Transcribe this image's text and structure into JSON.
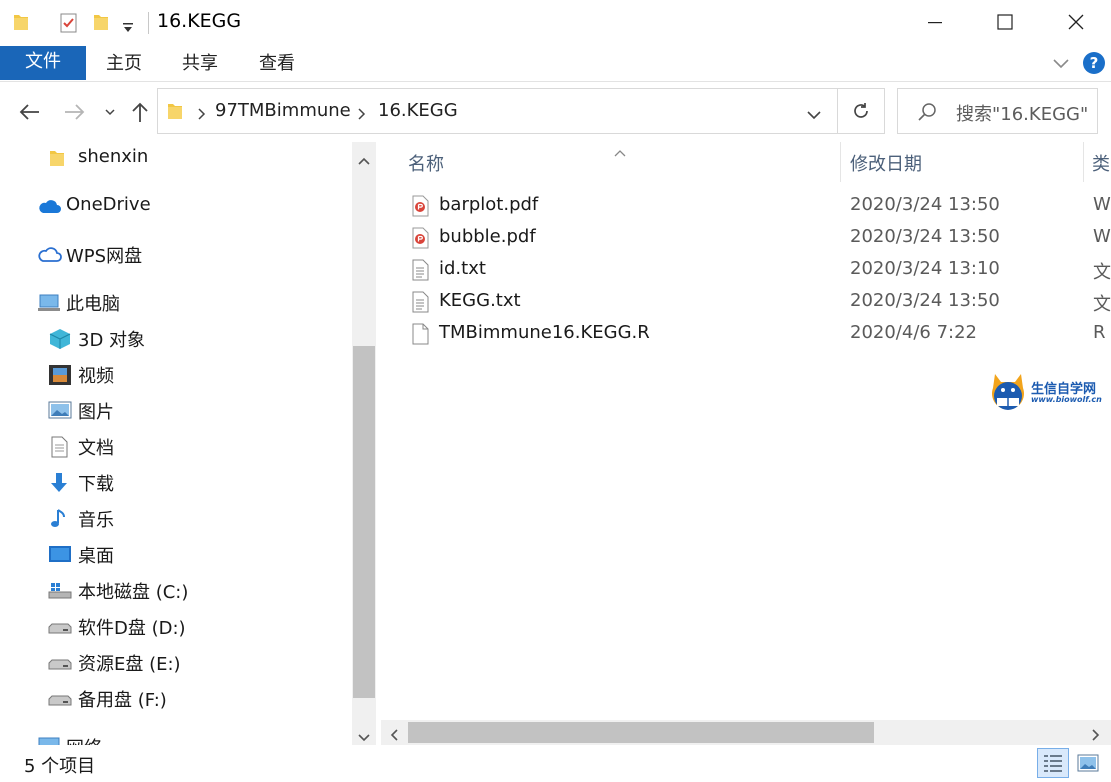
{
  "window": {
    "title": "16.KEGG",
    "controls": {
      "minimize": "minimize",
      "maximize": "maximize",
      "close": "close"
    }
  },
  "ribbon": {
    "tabs": [
      {
        "label": "文件",
        "active": true
      },
      {
        "label": "主页"
      },
      {
        "label": "共享"
      },
      {
        "label": "查看"
      }
    ],
    "help": "?"
  },
  "address": {
    "crumbs": [
      "97TMBimmune",
      "16.KEGG"
    ],
    "search_placeholder": "搜索\"16.KEGG\""
  },
  "sidebar": {
    "items": [
      {
        "label": "shenxin",
        "icon": "folder-icon"
      },
      {
        "label": "OneDrive",
        "icon": "cloud-icon"
      },
      {
        "label": "WPS网盘",
        "icon": "wps-cloud-icon"
      },
      {
        "label": "此电脑",
        "icon": "computer-icon"
      },
      {
        "label": "3D 对象",
        "icon": "cube-icon"
      },
      {
        "label": "视频",
        "icon": "video-icon"
      },
      {
        "label": "图片",
        "icon": "pictures-icon"
      },
      {
        "label": "文档",
        "icon": "document-icon"
      },
      {
        "label": "下载",
        "icon": "download-icon"
      },
      {
        "label": "音乐",
        "icon": "music-icon"
      },
      {
        "label": "桌面",
        "icon": "desktop-icon"
      },
      {
        "label": "本地磁盘 (C:)",
        "icon": "system-drive-icon"
      },
      {
        "label": "软件D盘 (D:)",
        "icon": "drive-icon"
      },
      {
        "label": "资源E盘 (E:)",
        "icon": "drive-icon"
      },
      {
        "label": "备用盘 (F:)",
        "icon": "drive-icon"
      },
      {
        "label": "网络",
        "icon": "network-icon"
      }
    ]
  },
  "list": {
    "columns": {
      "name": "名称",
      "date": "修改日期",
      "type": "类"
    },
    "files": [
      {
        "name": "barplot.pdf",
        "date": "2020/3/24 13:50",
        "type": "W",
        "icon": "pdf-icon"
      },
      {
        "name": "bubble.pdf",
        "date": "2020/3/24 13:50",
        "type": "W",
        "icon": "pdf-icon"
      },
      {
        "name": "id.txt",
        "date": "2020/3/24 13:10",
        "type": "文",
        "icon": "text-file-icon"
      },
      {
        "name": "KEGG.txt",
        "date": "2020/3/24 13:50",
        "type": "文",
        "icon": "text-file-icon"
      },
      {
        "name": "TMBimmune16.KEGG.R",
        "date": "2020/4/6 7:22",
        "type": "R",
        "icon": "blank-file-icon"
      }
    ]
  },
  "watermark": {
    "title": "生信自学网",
    "url": "www.biowolf.cn"
  },
  "status": {
    "count": "5 个项目"
  },
  "colors": {
    "accent": "#1a66b8",
    "folder": "#f2c744",
    "pdf": "#d9443a"
  }
}
